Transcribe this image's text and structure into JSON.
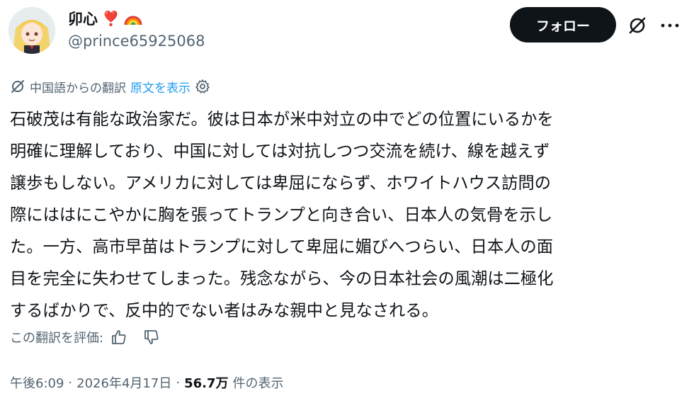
{
  "author": {
    "name": "卯心",
    "emoji_heart": "❣️",
    "emoji_rainbow": "🌈",
    "handle": "@prince65925068",
    "avatar_icon": "avatar-illustration"
  },
  "header": {
    "follow_label": "フォロー",
    "grok_icon": "grok-icon",
    "more_icon": "more-icon"
  },
  "translation": {
    "icon": "grok-icon",
    "label": "中国語からの翻訳",
    "show_original": "原文を表示",
    "settings_icon": "gear-icon"
  },
  "post": {
    "lines": [
      "石破茂は有能な政治家だ。彼は日本が米中対立の中でどの位置にいるかを",
      "明確に理解しており、中国に対しては対抗しつつ交流を続け、線を越えず",
      "譲歩もしない。アメリカに対しては卑屈にならず、ホワイトハウス訪問の",
      "際にははにこやかに胸を張ってトランプと向き合い、日本人の気骨を示し",
      "た。一方、高市早苗はトランプに対して卑屈に媚びへつらい、日本人の面",
      "目を完全に失わせてしまった。残念ながら、今の日本社会の風潮は二極化",
      "するばかりで、反中的でない者はみな親中と見なされる。"
    ]
  },
  "rating": {
    "label": "この翻訳を評価:",
    "thumbs_up_icon": "thumbs-up-icon",
    "thumbs_down_icon": "thumbs-down-icon"
  },
  "meta": {
    "time": "午後6:09",
    "sep1": "·",
    "date": "2026年4月17日",
    "sep2": "·",
    "views": "56.7万",
    "views_label": "件の表示"
  },
  "colors": {
    "text": "#0f1419",
    "secondary": "#536471",
    "link": "#1d9bf0",
    "button_bg": "#0f1419"
  }
}
